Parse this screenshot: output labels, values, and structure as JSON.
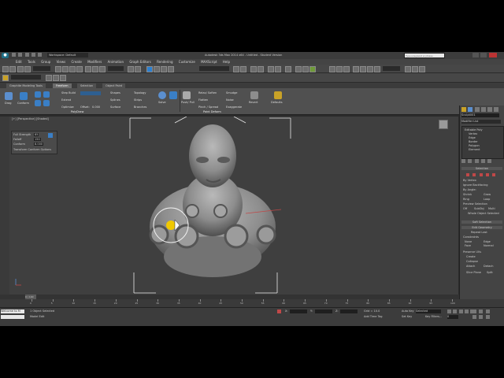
{
  "window": {
    "title": "Autodesk 3ds Max 2014 x64  - Untitled - Student Version",
    "workspace": "Workspace: Default",
    "search_placeholder": "Type a keyword or phrase"
  },
  "menubar": [
    "Edit",
    "Tools",
    "Group",
    "Views",
    "Create",
    "Modifiers",
    "Animation",
    "Graph Editors",
    "Rendering",
    "Customize",
    "MAXScript",
    "Help"
  ],
  "ribbon": {
    "tabs": [
      "Graphite Modeling Tools",
      "Freeform",
      "Selection",
      "Object Paint"
    ],
    "active_tab": "Freeform",
    "group_label": "PolyDraw",
    "group_label_2": "Paint Deform",
    "items": {
      "step_build": "Step Build",
      "extend": "Extend",
      "optimize": "Optimize",
      "shapes": "Shapes",
      "splines": "Splines",
      "surface": "Surface",
      "topology": "Topology",
      "strips": "Strips",
      "branches": "Branches",
      "relax_soften": "Relax/ Soften",
      "flatten": "Flatten",
      "pinch_spread": "Pinch / Spread",
      "smudge": "Smudge",
      "noise": "Noise",
      "exaggerate": "Exaggerate",
      "conform": "Conform",
      "drag": "Drag",
      "solve": "Solve",
      "push_pull": "Push/ Pull",
      "shift_rotate": "Shift Rotate",
      "revert": "Revert",
      "defaults": "Defaults",
      "offset_label": "Offset:",
      "offset_value": "0.000",
      "min_distance": "MinDis:"
    }
  },
  "viewport": {
    "label": "[+] [Perspective] [Shaded]",
    "conform": {
      "full_strength": "Full Strength",
      "full_strength_value": "85",
      "falloff": "Falloff",
      "falloff_value": "150",
      "conform": "Conform",
      "conform_value": "8.000",
      "options": "Transform Conform Options"
    }
  },
  "command_panel": {
    "object_name": "Sculpt001",
    "modifier_list": "Modifier List",
    "stack": [
      "Editable Poly",
      "Vertex",
      "Edge",
      "Border",
      "Polygon",
      "Element"
    ],
    "selection_rollout": "Selection",
    "by_vertex": "By Vertex",
    "ignore_backfacing": "Ignore Backfacing",
    "by_angle": "By Angle:",
    "shrink": "Shrink",
    "grow": "Grow",
    "ring": "Ring",
    "loop": "Loop",
    "preview_selection": "Preview Selection",
    "off": "Off",
    "subobj": "SubObj",
    "multi": "Multi",
    "whole_object": "Whole Object Selected",
    "soft_selection": "Soft Selection",
    "edit_geometry": "Edit Geometry",
    "repeat_last": "Repeat Last",
    "constraints": "Constraints",
    "none": "None",
    "edge": "Edge",
    "face": "Face",
    "normal": "Normal",
    "preserve_uvs": "Preserve UVs",
    "create": "Create",
    "collapse": "Collapse",
    "attach": "Attach",
    "detach": "Detach",
    "slice_plane": "Slice Plane",
    "split": "Split"
  },
  "timeline": {
    "frame": "0 / 100",
    "ticks": [
      "0",
      "5",
      "10",
      "15",
      "20",
      "25",
      "30",
      "35",
      "40",
      "45",
      "50",
      "55",
      "60",
      "65",
      "70",
      "75",
      "80",
      "85",
      "90",
      "95",
      "100"
    ]
  },
  "status": {
    "welcome": "Welcome to M",
    "selection": "1 Object Selected",
    "hint": "Model Edit",
    "grid": "Grid = 10.0",
    "add_time_tag": "Add Time Tag",
    "auto_key": "Auto Key",
    "selected": "Selected",
    "set_key": "Set Key",
    "key_filters": "Key Filters...",
    "x_label": "X:",
    "y_label": "Y:",
    "z_label": "Z:",
    "frame_value": "0"
  },
  "colors": {
    "viewport_bg": "#3f3f3f",
    "accent": "#2b7fd0",
    "selection_cursor": "#f0c800"
  }
}
